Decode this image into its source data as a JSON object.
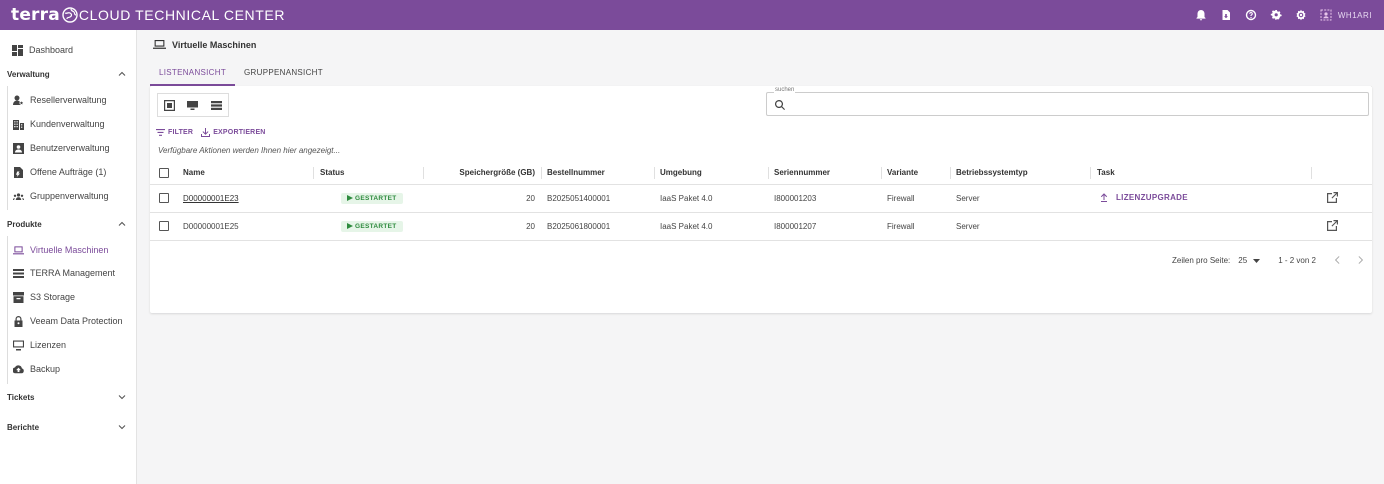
{
  "app": {
    "brand_main": "terra",
    "brand_rest": "CLOUD TECHNICAL CENTER",
    "user_name": "WH1ARI"
  },
  "colors": {
    "accent": "#7b4b9a",
    "status_green": "#2e8b3e"
  },
  "sidebar": {
    "dashboard": "Dashboard",
    "sections": {
      "verwaltung": "Verwaltung",
      "produkte": "Produkte",
      "tickets": "Tickets",
      "berichte": "Berichte"
    },
    "verwaltung_items": [
      "Resellerverwaltung",
      "Kundenverwaltung",
      "Benutzerverwaltung",
      "Offene Aufträge (1)",
      "Gruppenverwaltung"
    ],
    "produkte_items": [
      "Virtuelle Maschinen",
      "TERRA Management",
      "S3 Storage",
      "Veeam Data Protection",
      "Lizenzen",
      "Backup"
    ]
  },
  "main": {
    "title": "Virtuelle Maschinen",
    "tabs": [
      "LISTENANSICHT",
      "GRUPPENANSICHT"
    ],
    "search": {
      "label": "suchen",
      "value": ""
    },
    "actions": {
      "filter": "FILTER",
      "export": "EXPORTIEREN"
    },
    "hint": "Verfügbare Aktionen werden Ihnen hier angezeigt..."
  },
  "table": {
    "headers": [
      "Name",
      "Status",
      "Speichergröße (GB)",
      "Bestellnummer",
      "Umgebung",
      "Seriennummer",
      "Variante",
      "Betriebssystemtyp",
      "Task"
    ],
    "rows": [
      {
        "name": "D00000001E23",
        "status": "GESTARTET",
        "size": "20",
        "order": "B2025051400001",
        "env": "IaaS Paket 4.0",
        "serial": "I800001203",
        "variant": "Firewall",
        "os": "Server",
        "task": "LIZENZUPGRADE"
      },
      {
        "name": "D00000001E25",
        "status": "GESTARTET",
        "size": "20",
        "order": "B2025061800001",
        "env": "IaaS Paket 4.0",
        "serial": "I800001207",
        "variant": "Firewall",
        "os": "Server",
        "task": ""
      }
    ]
  },
  "pager": {
    "label": "Zeilen pro Seite:",
    "per_page": "25",
    "range": "1 - 2 von 2"
  }
}
